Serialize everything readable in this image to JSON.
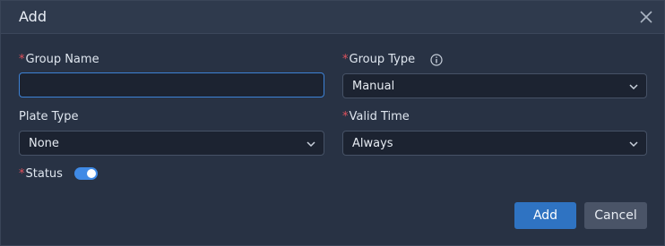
{
  "dialog": {
    "title": "Add",
    "close_icon": "close-icon"
  },
  "form": {
    "required_mark": "*",
    "group_name": {
      "label": "Group Name",
      "value": "",
      "placeholder": ""
    },
    "group_type": {
      "label": "Group Type",
      "value": "Manual",
      "info_icon": "info-icon"
    },
    "plate_type": {
      "label": "Plate Type",
      "value": "None"
    },
    "valid_time": {
      "label": "Valid Time",
      "value": "Always"
    },
    "status": {
      "label": "Status",
      "enabled": true
    }
  },
  "actions": {
    "add_label": "Add",
    "cancel_label": "Cancel"
  },
  "colors": {
    "accent": "#2f73c2",
    "required": "#e0525d",
    "toggle_on": "#3f8ae6"
  }
}
